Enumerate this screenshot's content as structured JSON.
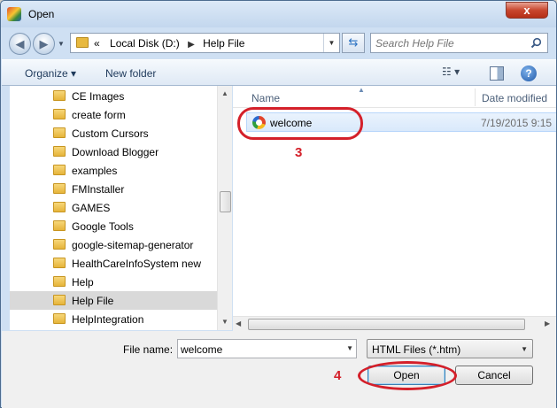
{
  "window": {
    "title": "Open",
    "close_label": "x"
  },
  "nav": {
    "back_glyph": "◀",
    "forward_glyph": "▶"
  },
  "address": {
    "overflow_glyph": "«",
    "crumbs": [
      "Local Disk (D:)",
      "Help File"
    ],
    "separator": "▶"
  },
  "search": {
    "placeholder": "Search Help File"
  },
  "toolbar": {
    "organize_label": "Organize ▾",
    "new_folder_label": "New folder",
    "help_label": "?"
  },
  "sidebar": {
    "items": [
      {
        "label": "CE Images"
      },
      {
        "label": "create form"
      },
      {
        "label": "Custom Cursors"
      },
      {
        "label": "Download Blogger"
      },
      {
        "label": "examples"
      },
      {
        "label": "FMInstaller"
      },
      {
        "label": "GAMES"
      },
      {
        "label": "Google Tools"
      },
      {
        "label": "google-sitemap-generator"
      },
      {
        "label": "HealthCareInfoSystem new"
      },
      {
        "label": "Help"
      },
      {
        "label": "Help File"
      },
      {
        "label": "HelpIntegration"
      }
    ],
    "selected_index": 11
  },
  "file_list": {
    "columns": {
      "name": "Name",
      "date": "Date modified"
    },
    "files": [
      {
        "name": "welcome",
        "date": "7/19/2015 9:15"
      }
    ]
  },
  "bottom": {
    "file_name_label": "File name:",
    "file_name_value": "welcome",
    "file_type": "HTML Files (*.htm)",
    "open_label": "Open",
    "cancel_label": "Cancel"
  },
  "annotations": {
    "step_file": "3",
    "step_open": "4"
  },
  "colors": {
    "annotation_red": "#d4202a",
    "selection_blue": "#d9e9fb"
  }
}
